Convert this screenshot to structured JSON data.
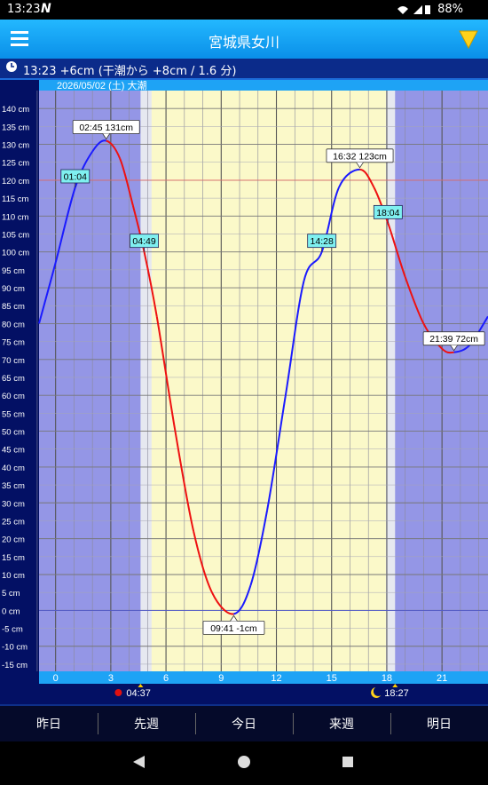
{
  "status": {
    "time": "13:23",
    "battery": "88%"
  },
  "header": {
    "title": "宮城県女川"
  },
  "info": {
    "text": "13:23 +6cm (干潮から +8cm / 1.6 分)"
  },
  "chart_data": {
    "type": "line",
    "date_label": "2026/05/02 (土) 大潮",
    "x_ticks": [
      0,
      3,
      6,
      9,
      12,
      15,
      18,
      21
    ],
    "y_ticks": [
      140,
      135,
      130,
      125,
      120,
      115,
      110,
      105,
      100,
      95,
      90,
      85,
      80,
      75,
      70,
      65,
      60,
      55,
      50,
      45,
      40,
      35,
      30,
      25,
      20,
      15,
      10,
      5,
      0,
      -5,
      -10,
      -15
    ],
    "unit": "cm",
    "ylim": [
      -17,
      145
    ],
    "xlim": [
      -0.9,
      23.5
    ],
    "highlights": [
      {
        "time": 2.75,
        "value": 131,
        "label": "02:45 131cm"
      },
      {
        "time": 9.683,
        "value": -1,
        "label": "09:41 -1cm"
      },
      {
        "time": 16.533,
        "value": 123,
        "label": "16:32 123cm"
      },
      {
        "time": 21.65,
        "value": 72,
        "label": "21:39 72cm"
      }
    ],
    "markers": [
      {
        "time": 1.067,
        "label": "01:04"
      },
      {
        "time": 4.817,
        "label": "04:49"
      },
      {
        "time": 14.467,
        "label": "14:28"
      },
      {
        "time": 18.067,
        "label": "18:04"
      }
    ],
    "series": [
      {
        "points": [
          [
            -0.9,
            80
          ],
          [
            0.0,
            97
          ],
          [
            1.067,
            118
          ],
          [
            2.0,
            128
          ],
          [
            2.75,
            131
          ],
          [
            3.5,
            126
          ],
          [
            4.2,
            113
          ],
          [
            4.817,
            100
          ],
          [
            5.5,
            82
          ],
          [
            6.5,
            50
          ],
          [
            7.5,
            22
          ],
          [
            8.5,
            5
          ],
          [
            9.683,
            -1
          ],
          [
            10.6,
            7
          ],
          [
            11.5,
            28
          ],
          [
            12.5,
            60
          ],
          [
            13.5,
            92
          ],
          [
            14.467,
            100
          ],
          [
            15.4,
            118
          ],
          [
            16.533,
            123
          ],
          [
            17.3,
            118
          ],
          [
            18.067,
            108
          ],
          [
            19.0,
            93
          ],
          [
            20.0,
            80
          ],
          [
            21.0,
            73
          ],
          [
            21.65,
            72
          ],
          [
            22.5,
            74
          ],
          [
            23.5,
            82
          ]
        ]
      }
    ],
    "sunrise": "04:37",
    "sunset": "18:27",
    "colors": {
      "rising": "#1a1aff",
      "falling": "#ee1111",
      "night": "#9496e6",
      "day": "#fbf9c9",
      "twilight": "#e6e8f0"
    }
  },
  "tabs": {
    "yesterday": "昨日",
    "prev_week": "先週",
    "today": "今日",
    "next_week": "来週",
    "tomorrow": "明日"
  }
}
